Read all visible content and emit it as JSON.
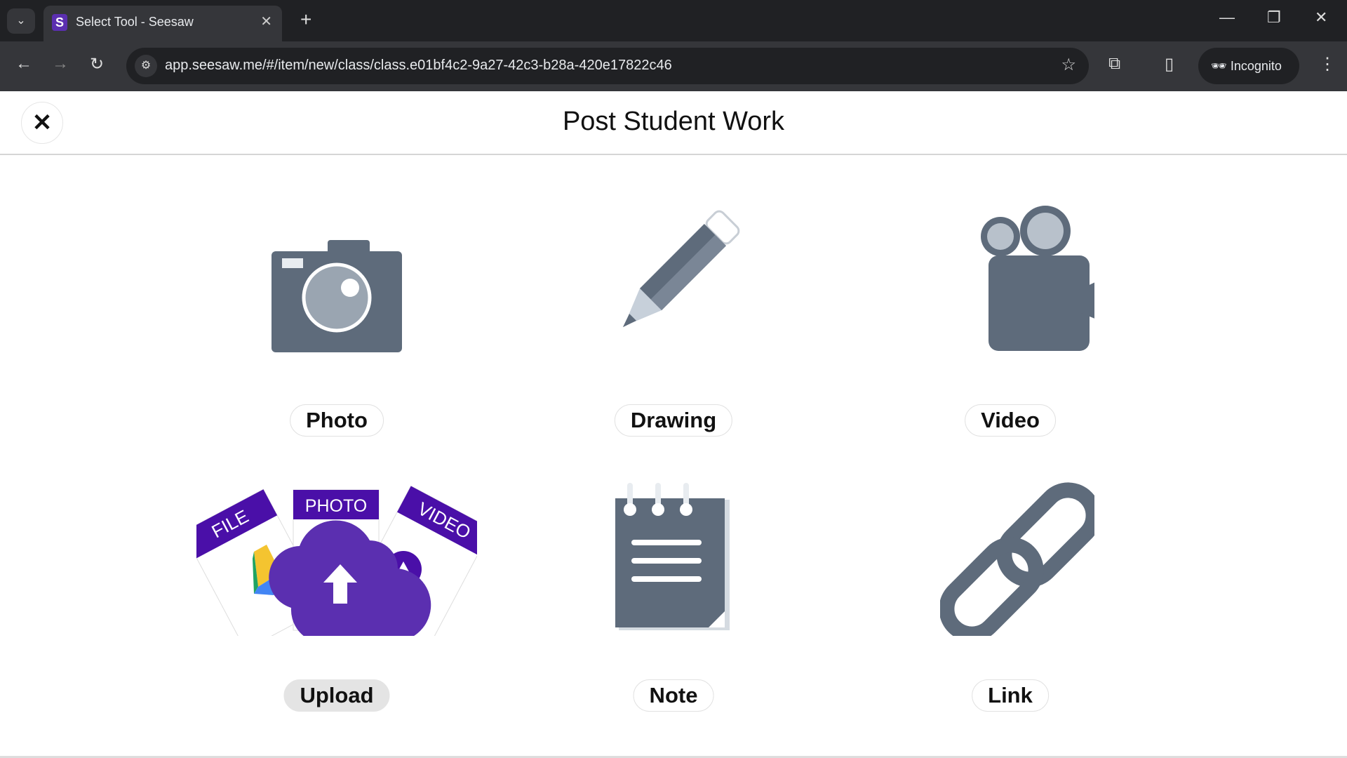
{
  "browser": {
    "tab_title": "Select Tool - Seesaw",
    "favicon_letter": "S",
    "url": "app.seesaw.me/#/item/new/class/class.e01bf4c2-9a27-42c3-b28a-420e17822c46",
    "profile": "Incognito"
  },
  "header": {
    "title": "Post Student Work",
    "close_label": "✕"
  },
  "tools": [
    {
      "label": "Photo",
      "icon": "camera-icon"
    },
    {
      "label": "Drawing",
      "icon": "pencil-icon"
    },
    {
      "label": "Video",
      "icon": "video-camera-icon"
    },
    {
      "label": "Upload",
      "icon": "upload-cloud-icon",
      "badges": [
        "FILE",
        "PHOTO",
        "VIDEO"
      ],
      "hovered": true
    },
    {
      "label": "Note",
      "icon": "notepad-icon"
    },
    {
      "label": "Link",
      "icon": "link-icon"
    }
  ],
  "colors": {
    "icon_gray": "#5e6b7b",
    "upload_purple": "#5b2fb0",
    "badge_purple": "#4a0fa8"
  }
}
